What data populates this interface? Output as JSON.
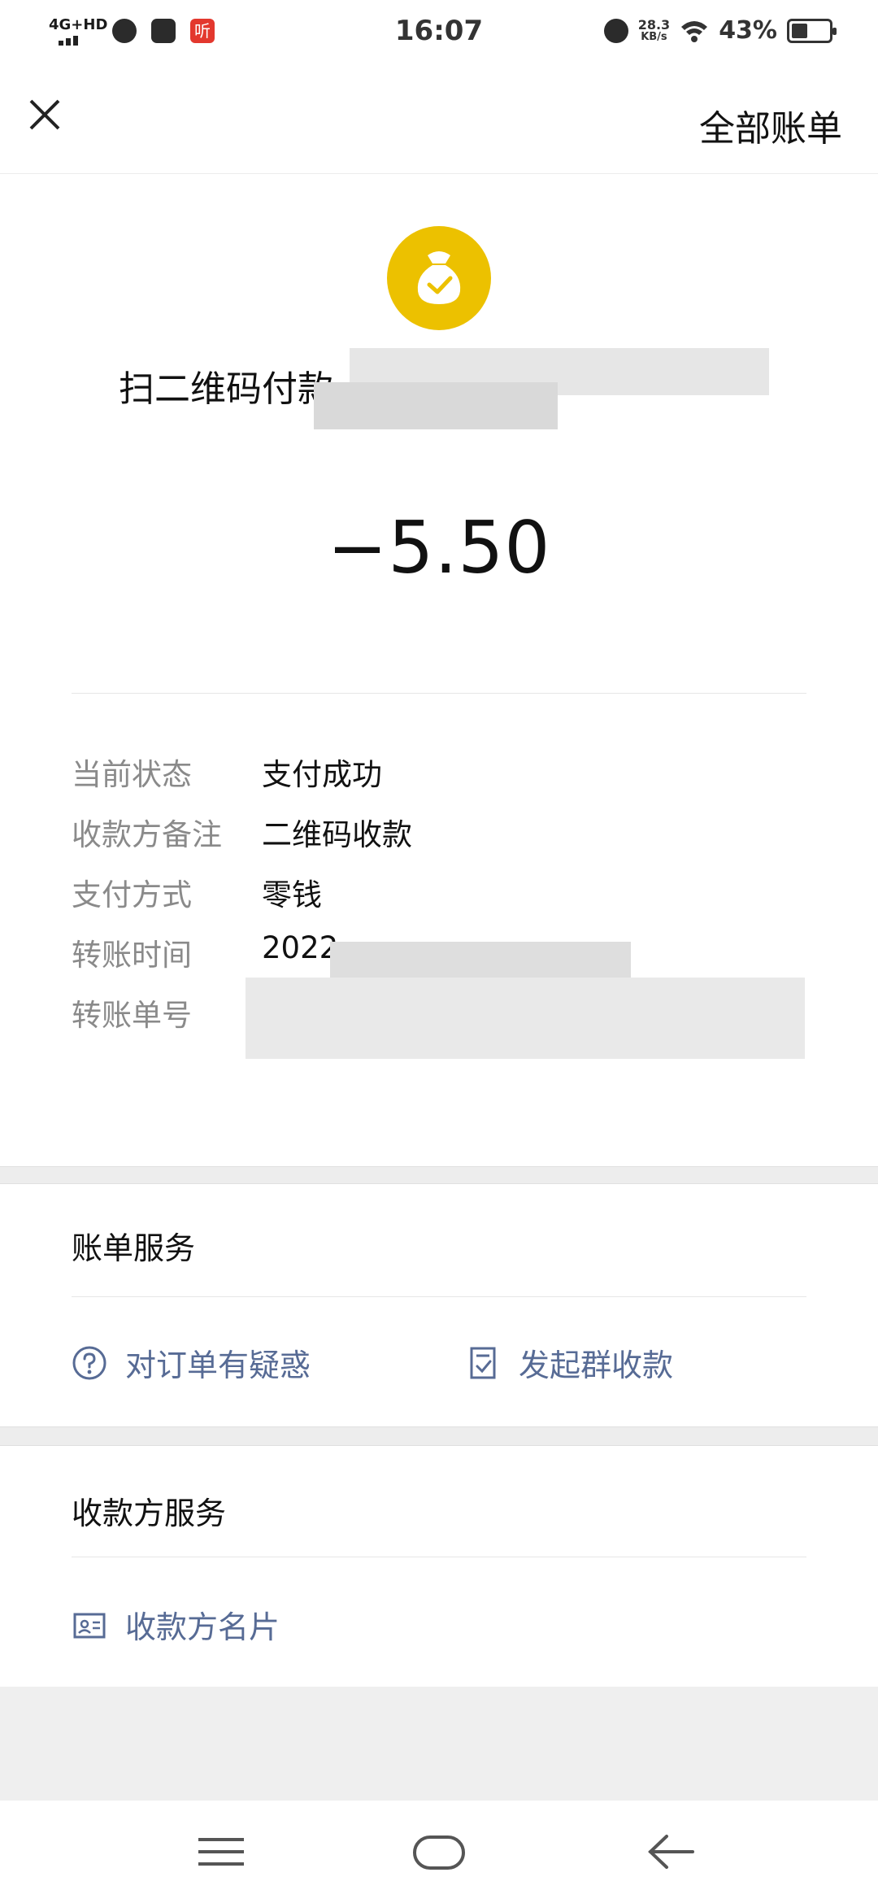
{
  "status_bar": {
    "network": "4G+HD",
    "app_icon_red_label": "听",
    "time": "16:07",
    "speed_value": "28.3",
    "speed_unit": "KB/s",
    "battery": "43%"
  },
  "nav": {
    "all_bills": "全部账单"
  },
  "transaction": {
    "title_prefix": "扫二维码付款-",
    "amount": "−5.50"
  },
  "details": [
    {
      "label": "当前状态",
      "value": "支付成功"
    },
    {
      "label": "收款方备注",
      "value": "二维码收款"
    },
    {
      "label": "支付方式",
      "value": "零钱"
    },
    {
      "label": "转账时间",
      "value": "2022"
    },
    {
      "label": "转账单号",
      "value": ""
    }
  ],
  "bill_service": {
    "title": "账单服务",
    "actions": [
      {
        "label": "对订单有疑惑",
        "icon": "question-circle-icon"
      },
      {
        "label": "发起群收款",
        "icon": "document-check-icon"
      }
    ]
  },
  "payee_service": {
    "title": "收款方服务",
    "actions": [
      {
        "label": "收款方名片",
        "icon": "id-card-icon"
      }
    ]
  },
  "colors": {
    "accent_coin": "#ecc100",
    "link": "#576b95"
  }
}
